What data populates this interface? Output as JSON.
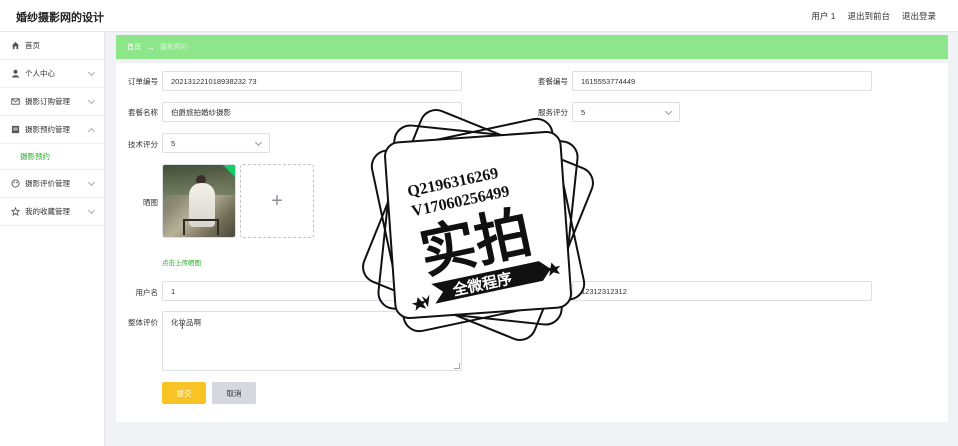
{
  "app": {
    "title": "婚纱摄影网的设计"
  },
  "topnav": {
    "user": "用户 1",
    "back_to_front": "退出到前台",
    "logout": "退出登录"
  },
  "sidebar": {
    "items": [
      {
        "label": "首页",
        "icon": "home-icon"
      },
      {
        "label": "个人中心",
        "icon": "user-icon"
      },
      {
        "label": "摄影订购管理",
        "icon": "mail-icon"
      },
      {
        "label": "摄影预约管理",
        "icon": "list-icon"
      },
      {
        "label": "摄影预约",
        "icon": ""
      },
      {
        "label": "摄影评价管理",
        "icon": "palette-icon"
      },
      {
        "label": "我的收藏管理",
        "icon": "star-icon"
      }
    ]
  },
  "breadcrumb": {
    "home": "首页",
    "arrow": "→",
    "current": "摄影预约"
  },
  "form": {
    "order_no_label": "订单编号",
    "order_no": "202131221018938232 73",
    "package_no_label": "套餐编号",
    "package_no": "1615553774449",
    "package_name_label": "套餐名称",
    "package_name": "伯爵旅拍婚纱摄影",
    "service_score_label": "服务评分",
    "service_score": "5",
    "tech_score_label": "技术评分",
    "tech_score": "5",
    "photo_label": "晒图",
    "upload_plus": "+",
    "upload_hint": "点击上传晒图",
    "username_label": "用户名",
    "username": "1",
    "phone_label": "联系电话",
    "phone": "12312312312",
    "review_label": "整体评价",
    "review": "化妆品啊",
    "submit": "提交",
    "cancel": "取消"
  },
  "watermark": {
    "line1": "Q2196316269",
    "line2": "V17060256499",
    "big": "实拍",
    "ribbon": "全微程序"
  },
  "colors": {
    "breadcrumb_bg": "#8de68a",
    "accent_green": "#22b022",
    "submit_bg": "#f7c325"
  }
}
